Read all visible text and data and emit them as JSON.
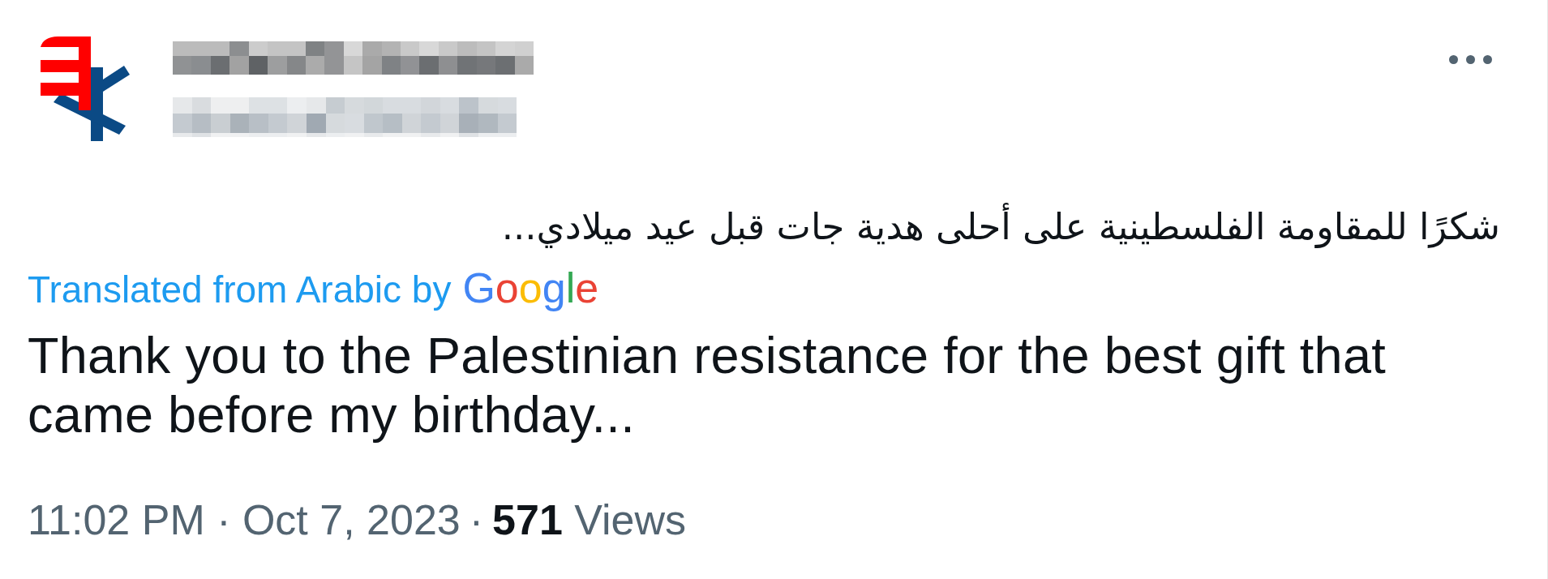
{
  "author": {
    "avatar": {
      "kind": "logo"
    },
    "name": {
      "kind": "pixelated"
    },
    "handle": {
      "kind": "pixelated"
    }
  },
  "original_text": "شكرًا للمقاومة الفلسطينية على أحلى هدية جات قبل عيد ميلادي...",
  "translation": {
    "label": "Translated from Arabic by",
    "provider": "Google",
    "text": "Thank you to the Palestinian resistance for the best gift that came before my birthday..."
  },
  "meta": {
    "timestamp": "11:02 PM · Oct 7, 2023",
    "separator": "·",
    "views": "**571** Views"
  }
}
